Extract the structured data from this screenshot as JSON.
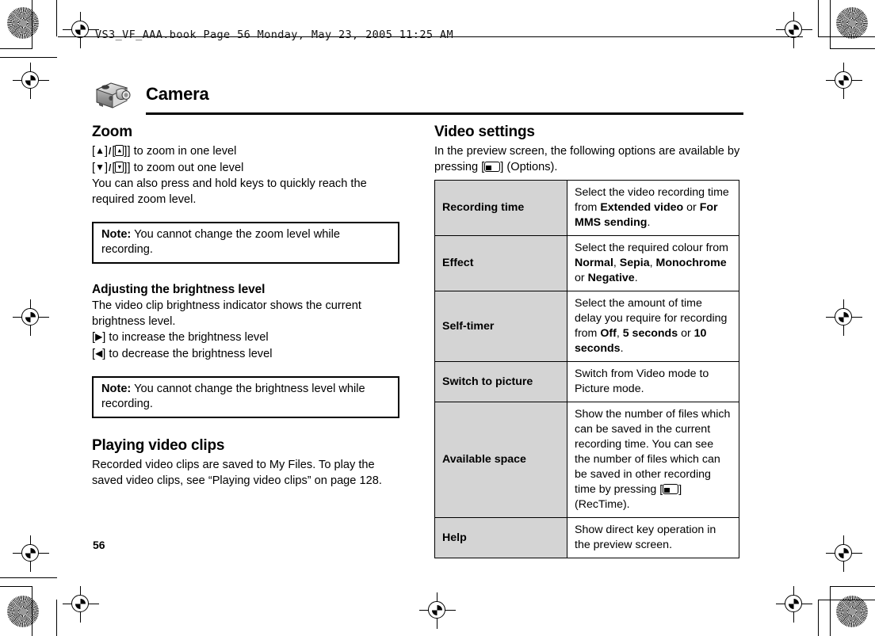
{
  "header": {
    "file_line": "VS3_VF_AAA.book  Page 56  Monday, May 23, 2005  11:25 AM"
  },
  "chapter": {
    "icon": "camera-icon",
    "title": "Camera"
  },
  "page_number": "56",
  "colors": {
    "table_key_bg": "#d4d4d4",
    "rule": "#000000",
    "page_bg": "#ffffff"
  },
  "left_column": {
    "zoom": {
      "heading": "Zoom",
      "line_in_pre": "[",
      "line_in_post": "] to zoom in one level",
      "line_out_post": "] to zoom out one level",
      "triangle_up": "▲",
      "triangle_down": "▼",
      "sidekey_up": "▴",
      "sidekey_down": "▾",
      "separator": "/",
      "body": "You can also press and hold keys to quickly reach the required zoom level.",
      "note_label": "Note:",
      "note_text": "You cannot change the zoom level while recording."
    },
    "brightness": {
      "heading": "Adjusting the brightness level",
      "body": "The video clip brightness indicator shows the current brightness level.",
      "triangle_right": "▶",
      "triangle_left": "◀",
      "increase_text": "] to increase the brightness level",
      "decrease_text": "] to decrease the brightness level",
      "bracket_open": "[",
      "note_label": "Note:",
      "note_text": "You cannot change the brightness level while recording."
    },
    "playing": {
      "heading": "Playing video clips",
      "body": "Recorded video clips are saved to My Files. To play the saved video clips, see “Playing video clips” on page 128."
    }
  },
  "right_column": {
    "heading": "Video settings",
    "intro_pre": "In the preview screen, the following options are available by pressing [",
    "intro_post": "] (Options).",
    "table": {
      "rows": [
        {
          "key": "Recording time",
          "value_parts": [
            {
              "t": "Select the video recording time from ",
              "b": false
            },
            {
              "t": "Extended video",
              "b": true
            },
            {
              "t": " or ",
              "b": false
            },
            {
              "t": "For MMS sending",
              "b": true
            },
            {
              "t": ".",
              "b": false
            }
          ]
        },
        {
          "key": "Effect",
          "value_parts": [
            {
              "t": "Select the required colour from ",
              "b": false
            },
            {
              "t": "Normal",
              "b": true
            },
            {
              "t": ", ",
              "b": false
            },
            {
              "t": "Sepia",
              "b": true
            },
            {
              "t": ", ",
              "b": false
            },
            {
              "t": "Monochrome",
              "b": true
            },
            {
              "t": " or ",
              "b": false
            },
            {
              "t": "Negative",
              "b": true
            },
            {
              "t": ".",
              "b": false
            }
          ]
        },
        {
          "key": "Self-timer",
          "value_parts": [
            {
              "t": "Select the amount of time delay you require for recording from ",
              "b": false
            },
            {
              "t": "Off",
              "b": true
            },
            {
              "t": ", ",
              "b": false
            },
            {
              "t": "5 seconds",
              "b": true
            },
            {
              "t": " or ",
              "b": false
            },
            {
              "t": "10 seconds",
              "b": true
            },
            {
              "t": ".",
              "b": false
            }
          ]
        },
        {
          "key": "Switch to picture",
          "value_parts": [
            {
              "t": "Switch from Video mode to Picture mode.",
              "b": false
            }
          ]
        },
        {
          "key": "Available space",
          "value_parts": [
            {
              "t": "Show the number of files which can be saved in the current recording time. You can see the number of files which can be saved in other recording time by pressing [",
              "b": false
            },
            {
              "t": "__SOFTKEY__",
              "b": false
            },
            {
              "t": "] (RecTime).",
              "b": false
            }
          ]
        },
        {
          "key": "Help",
          "value_parts": [
            {
              "t": "Show direct key operation in the preview screen.",
              "b": false
            }
          ]
        }
      ]
    }
  }
}
